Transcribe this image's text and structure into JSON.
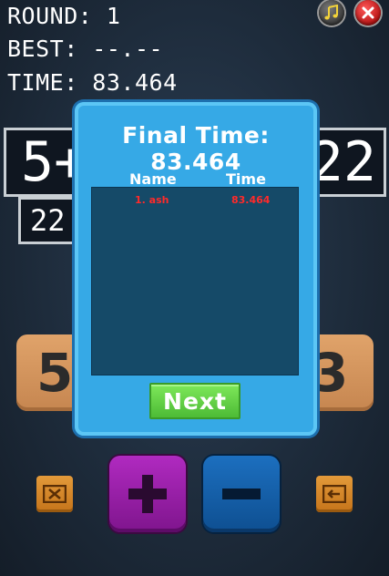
{
  "hud": {
    "round": "ROUND: 1",
    "best": "BEST: --.--",
    "time": "TIME: 83.464"
  },
  "top_buttons": {
    "music_icon": "music-note-icon",
    "close_icon": "close-icon"
  },
  "equation": {
    "left": "5+",
    "right": "22",
    "small": "22"
  },
  "tiles": {
    "left": "5",
    "right": "3"
  },
  "dialog": {
    "title": "Final Time: 83.464",
    "col_name": "Name",
    "col_time": "Time",
    "scores": [
      {
        "name": "1. ash",
        "time": "83.464"
      }
    ],
    "next_label": "Next"
  },
  "controls": {
    "clear_icon": "clear-x-icon",
    "plus_icon": "plus-icon",
    "minus_icon": "minus-icon",
    "back_icon": "backspace-arrow-icon"
  },
  "colors": {
    "dialog": "#36a9e6",
    "score_text": "#ff2a2a",
    "next_button": "#5fcf44",
    "plus_button": "#9b1fab",
    "minus_button": "#155fa9",
    "tile": "#d6955c"
  }
}
